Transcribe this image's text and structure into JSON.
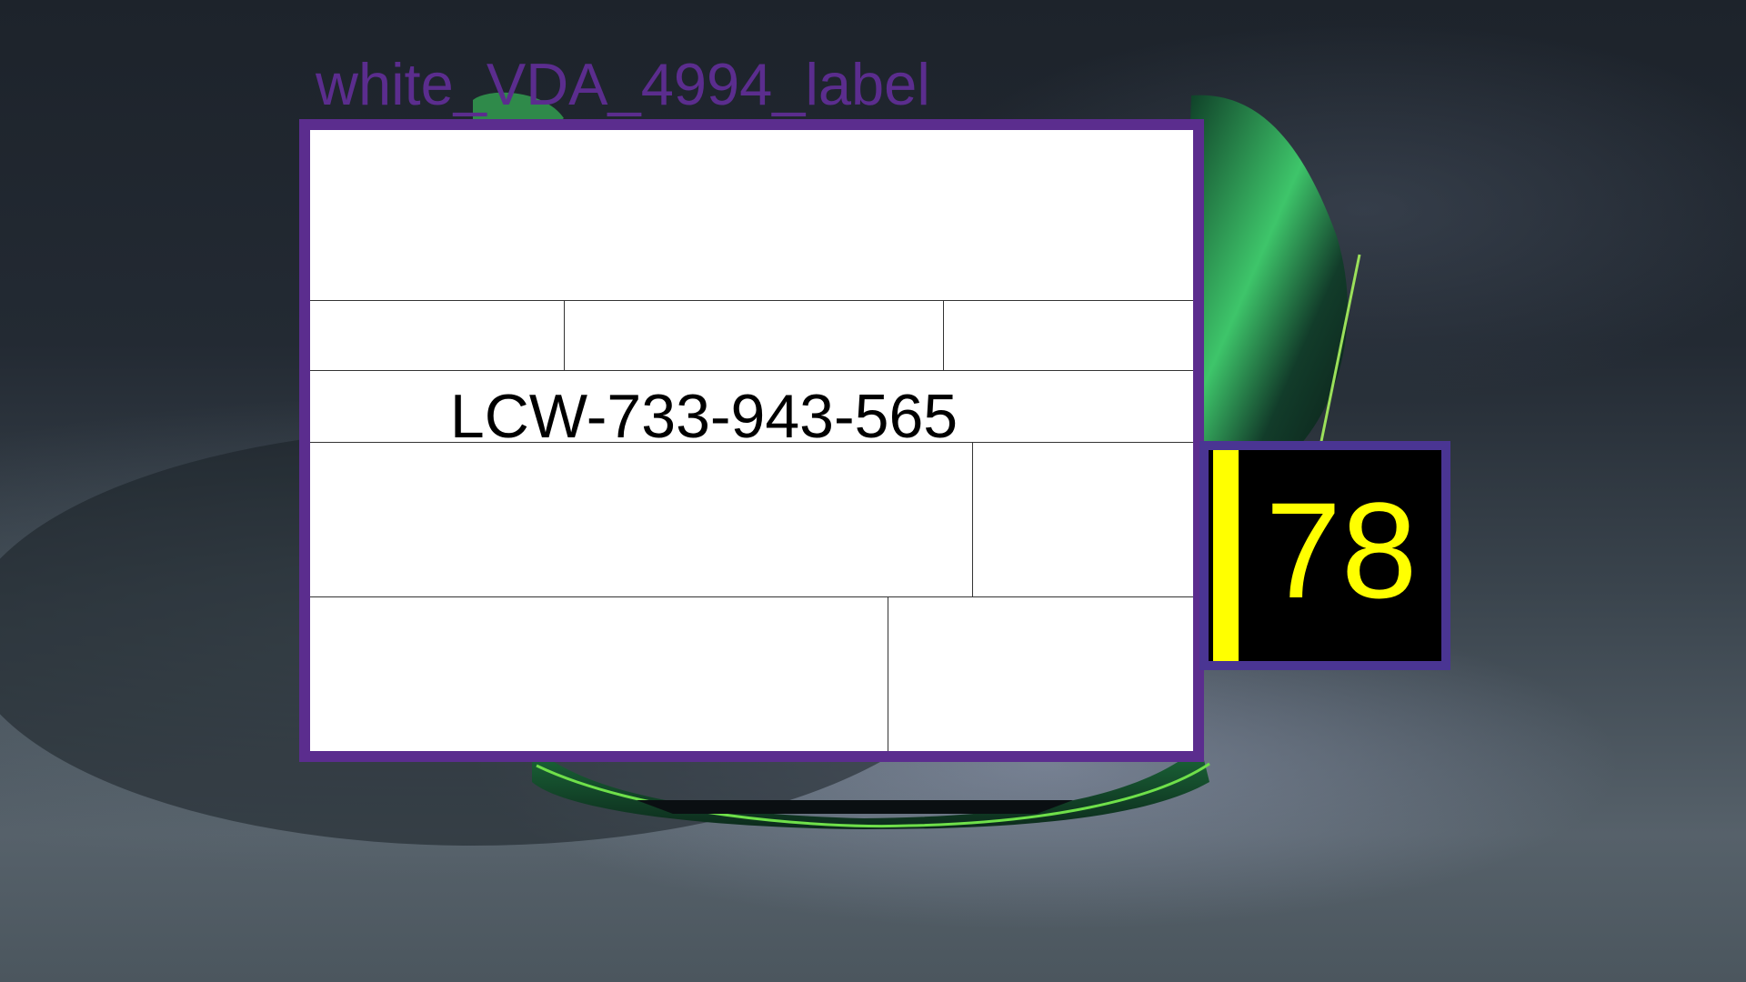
{
  "label": {
    "caption": "white_VDA_4994_label",
    "code": "LCW-733-943-565"
  },
  "badge": {
    "number": "78"
  },
  "colors": {
    "frame": "#5b2d8e",
    "badge_frame": "#4a3593",
    "badge_accent": "#ffff00",
    "car_accent": "#39c83c"
  },
  "icons": {
    "background": "green-sports-car-photo"
  }
}
